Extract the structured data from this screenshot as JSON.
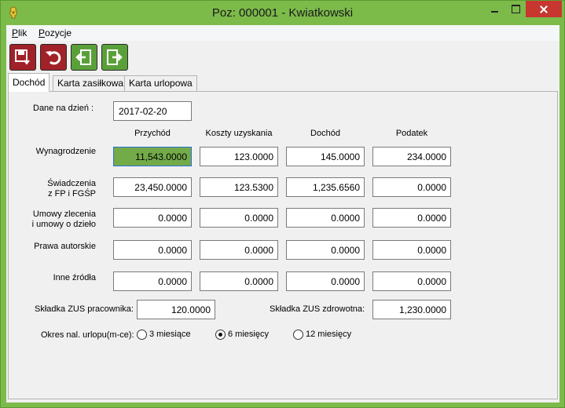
{
  "window": {
    "title": "Poz: 000001 - Kwiatkowski",
    "colors": {
      "frame": "#7cba4a",
      "close": "#c7372f",
      "highlight_field": "#73ab49"
    }
  },
  "menu": {
    "items": [
      {
        "key": "P",
        "rest": "lik"
      },
      {
        "key": "P",
        "rest": "ozycje"
      }
    ]
  },
  "toolbar": {
    "buttons": [
      {
        "icon": "save-icon",
        "color": "#a02228"
      },
      {
        "icon": "undo-icon",
        "color": "#a02228"
      },
      {
        "icon": "previous-icon",
        "color": "#5aa03a"
      },
      {
        "icon": "next-icon",
        "color": "#5aa03a"
      }
    ]
  },
  "tabs": [
    {
      "label": "Dochód"
    },
    {
      "label": "Karta zasiłkowa"
    },
    {
      "label": "Karta urlopowa"
    }
  ],
  "form": {
    "date_label": "Dane na dzień :",
    "date_value": "2017-02-20",
    "columns": [
      "Przychód",
      "Koszty uzyskania",
      "Dochód",
      "Podatek"
    ],
    "rows": [
      {
        "label1": "Wynagrodzenie",
        "label2": "",
        "values": [
          "11,543.0000",
          "123.0000",
          "145.0000",
          "234.0000"
        ]
      },
      {
        "label1": "Świadczenia",
        "label2": "z FP i FGŚP",
        "values": [
          "23,450.0000",
          "123.5300",
          "1,235.6560",
          "0.0000"
        ]
      },
      {
        "label1": "Umowy zlecenia",
        "label2": "i umowy o dzieło",
        "values": [
          "0.0000",
          "0.0000",
          "0.0000",
          "0.0000"
        ]
      },
      {
        "label1": "Prawa autorskie",
        "label2": "",
        "values": [
          "0.0000",
          "0.0000",
          "0.0000",
          "0.0000"
        ]
      },
      {
        "label1": "Inne źródła",
        "label2": "",
        "values": [
          "0.0000",
          "0.0000",
          "0.0000",
          "0.0000"
        ]
      }
    ],
    "zus_pracownika_label": "Składka ZUS pracownika:",
    "zus_pracownika_value": "120.0000",
    "zus_zdrowotna_label": "Składka ZUS zdrowotna:",
    "zus_zdrowotna_value": "1,230.0000",
    "okres_label": "Okres nal. urlopu(m-ce):",
    "okres_options": [
      "3 miesiące",
      "6 miesięcy",
      "12 miesięcy"
    ],
    "okres_selected": "6 miesięcy"
  }
}
